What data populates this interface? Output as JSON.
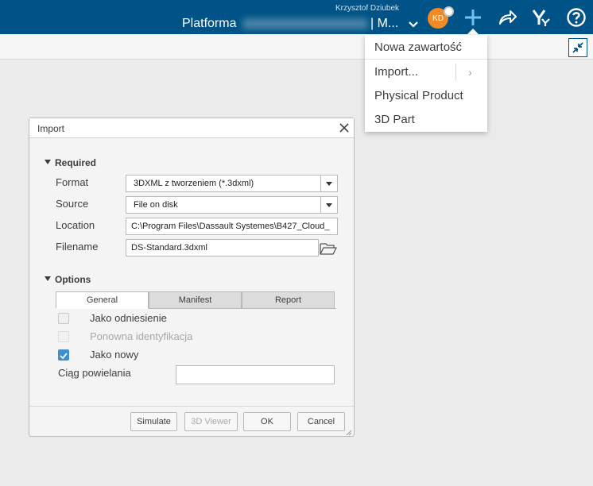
{
  "header": {
    "user_name": "Krzysztof Dziubek",
    "platform_label": "Platforma",
    "app_label": "| M...",
    "avatar_initials": "KD",
    "brand_color": "#005386",
    "avatar_color": "#f08a24"
  },
  "add_menu": {
    "items": [
      {
        "label": "Nowa zawartość"
      },
      {
        "label": "Import..."
      },
      {
        "label": "Physical Product"
      },
      {
        "label": "3D Part"
      }
    ]
  },
  "dialog": {
    "title": "Import",
    "required": {
      "title": "Required",
      "format_label": "Format",
      "format_value": "3DXML z tworzeniem (*.3dxml)",
      "source_label": "Source",
      "source_value": "File on disk",
      "location_label": "Location",
      "location_value": "C:\\Program Files\\Dassault Systemes\\B427_Cloud_",
      "filename_label": "Filename",
      "filename_value": "DS-Standard.3dxml"
    },
    "options": {
      "title": "Options",
      "tabs": [
        {
          "label": "General",
          "active": true
        },
        {
          "label": "Manifest",
          "active": false
        },
        {
          "label": "Report",
          "active": false
        }
      ],
      "checkboxes": [
        {
          "label": "Jako odniesienie",
          "checked": false,
          "disabled": false
        },
        {
          "label": "Ponowna identyfikacja",
          "checked": false,
          "disabled": true
        },
        {
          "label": "Jako nowy",
          "checked": true,
          "disabled": false
        }
      ],
      "dup_string_label": "Ciąg powielania",
      "dup_string_value": ""
    },
    "buttons": {
      "simulate": "Simulate",
      "viewer": "3D Viewer",
      "ok": "OK",
      "cancel": "Cancel"
    }
  }
}
